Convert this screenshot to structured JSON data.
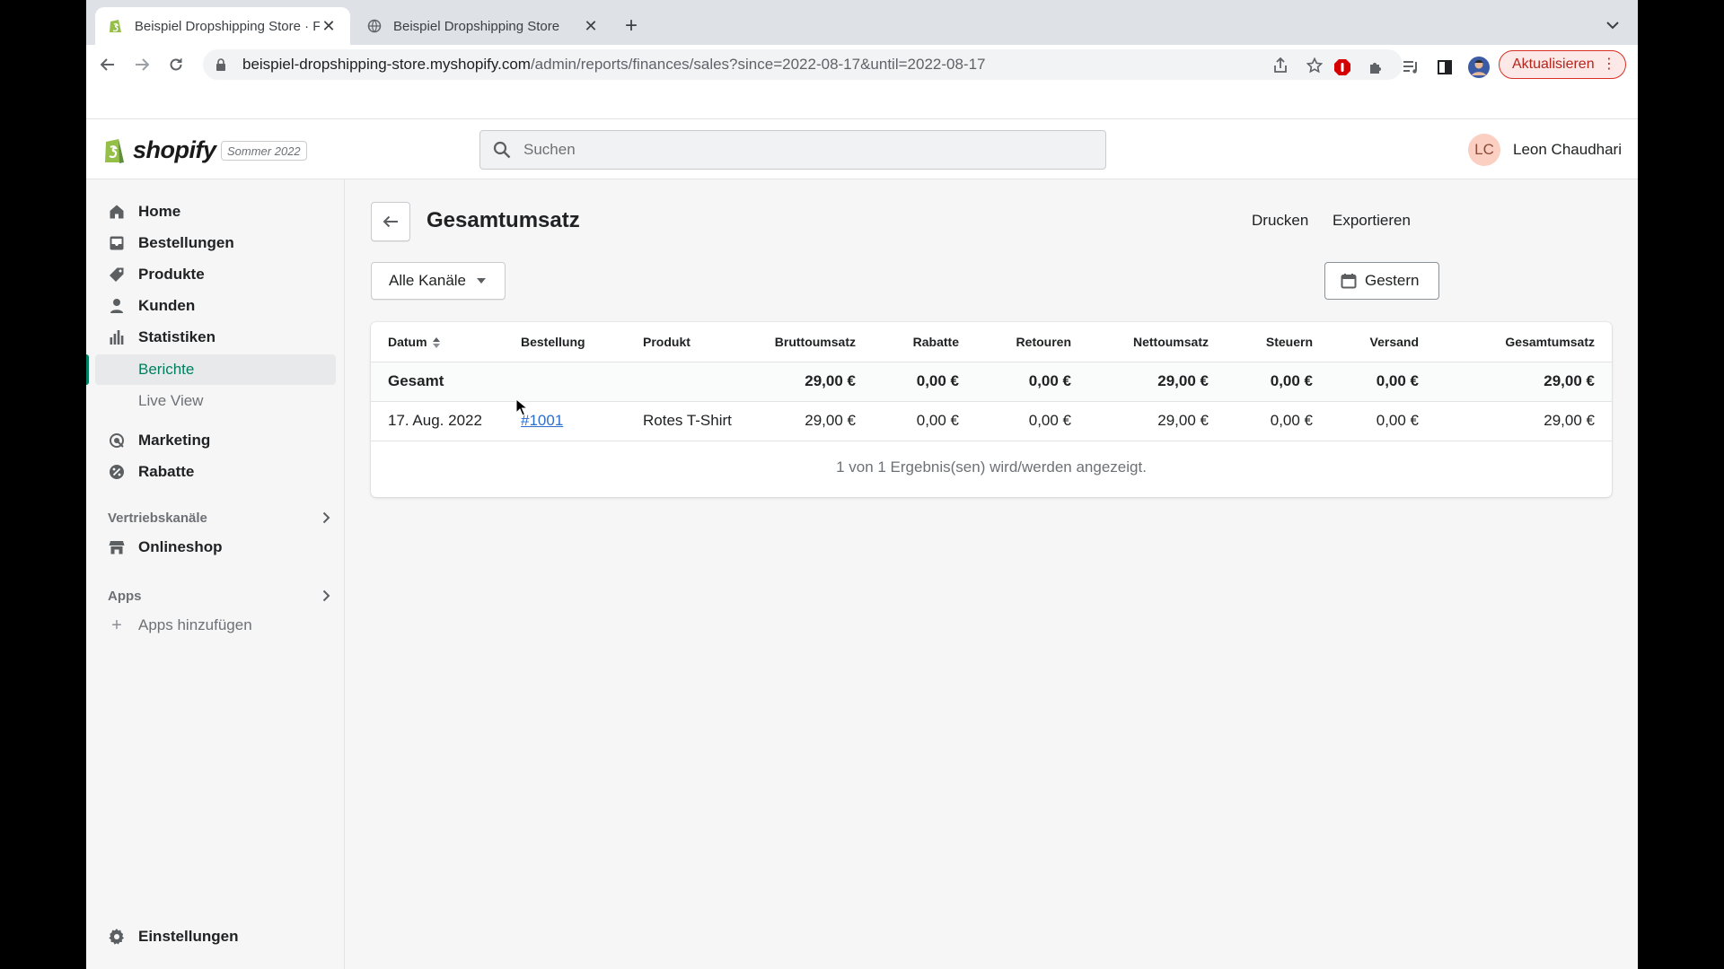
{
  "browser": {
    "tabs": [
      {
        "title": "Beispiel Dropshipping Store · F",
        "active": true
      },
      {
        "title": "Beispiel Dropshipping Store",
        "active": false
      }
    ],
    "url_host": "beispiel-dropshipping-store.myshopify.com",
    "url_path": "/admin/reports/finances/sales?since=2022-08-17&until=2022-08-17",
    "update_label": "Aktualisieren"
  },
  "topbar": {
    "logo_text": "shopify",
    "season_badge": "Sommer 2022",
    "search_placeholder": "Suchen",
    "user_initials": "LC",
    "user_name": "Leon Chaudhari"
  },
  "sidebar": {
    "items": [
      {
        "label": "Home",
        "icon": "home-icon"
      },
      {
        "label": "Bestellungen",
        "icon": "orders-icon"
      },
      {
        "label": "Produkte",
        "icon": "tag-icon"
      },
      {
        "label": "Kunden",
        "icon": "person-icon"
      },
      {
        "label": "Statistiken",
        "icon": "bar-chart-icon"
      }
    ],
    "sub_items": [
      {
        "label": "Berichte",
        "selected": true
      },
      {
        "label": "Live View",
        "selected": false
      }
    ],
    "items2": [
      {
        "label": "Marketing",
        "icon": "target-icon"
      },
      {
        "label": "Rabatte",
        "icon": "discount-icon"
      }
    ],
    "sales_channels_header": "Vertriebskanäle",
    "online_store": "Onlineshop",
    "apps_header": "Apps",
    "add_apps": "Apps hinzufügen",
    "settings": "Einstellungen"
  },
  "page": {
    "title": "Gesamtumsatz",
    "print_label": "Drucken",
    "export_label": "Exportieren",
    "channel_filter": "Alle Kanäle",
    "date_filter": "Gestern"
  },
  "table": {
    "columns": [
      "Datum",
      "Bestellung",
      "Produkt",
      "Bruttoumsatz",
      "Rabatte",
      "Retouren",
      "Nettoumsatz",
      "Steuern",
      "Versand",
      "Gesamtumsatz"
    ],
    "total_row": [
      "Gesamt",
      "",
      "",
      "29,00 €",
      "0,00 €",
      "0,00 €",
      "29,00 €",
      "0,00 €",
      "0,00 €",
      "29,00 €"
    ],
    "rows": [
      [
        "17. Aug. 2022",
        "#1001",
        "Rotes T-Shirt",
        "29,00 €",
        "0,00 €",
        "0,00 €",
        "29,00 €",
        "0,00 €",
        "0,00 €",
        "29,00 €"
      ]
    ],
    "footer": "1 von 1 Ergebnis(sen) wird/werden angezeigt."
  },
  "colors": {
    "accent_green": "#008060",
    "link_blue": "#2c6ecb",
    "update_red": "#d93025"
  }
}
